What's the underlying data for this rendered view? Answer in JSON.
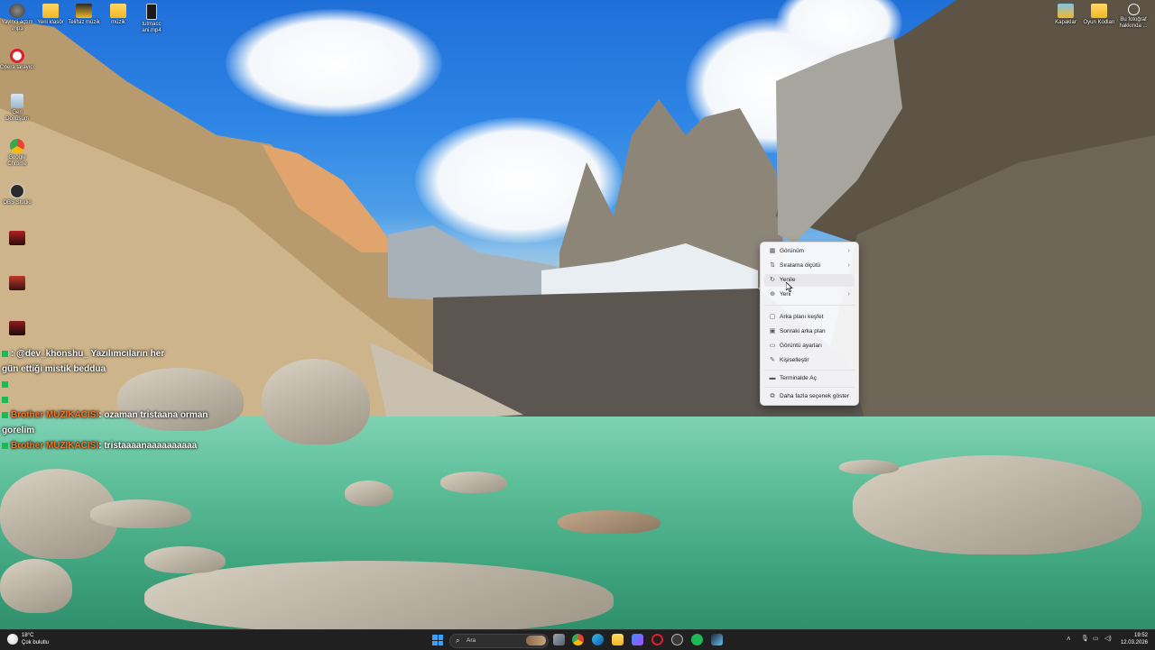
{
  "desktop_icons_left": [
    {
      "label": "Yayinci açtım .mp3",
      "icon": "audio-file-icon"
    },
    {
      "label": "Opera tarayıcı",
      "icon": "opera-icon"
    },
    {
      "label": "Geri Dönüşüm",
      "icon": "recycle-bin-icon"
    },
    {
      "label": "Google Chrome",
      "icon": "chrome-icon"
    },
    {
      "label": "OBS Studio",
      "icon": "obs-icon"
    },
    {
      "label": "",
      "icon": "game-icon"
    },
    {
      "label": "",
      "icon": "game-icon"
    },
    {
      "label": "",
      "icon": "game-icon"
    }
  ],
  "desktop_icons_top": [
    {
      "label": "Yeni klasör",
      "icon": "folder-icon"
    },
    {
      "label": "Telifsiz müzik",
      "icon": "folder-icon"
    },
    {
      "label": "müzik",
      "icon": "folder-icon"
    },
    {
      "label": "tutmacc ani.mp4",
      "icon": "video-file-icon"
    }
  ],
  "desktop_icons_right": [
    {
      "label": "Kapaklar",
      "icon": "folder-icon"
    },
    {
      "label": "Oyun Kodları",
      "icon": "folder-icon"
    },
    {
      "label": "Bu fotoğraf hakkında ...",
      "icon": "info-icon"
    }
  ],
  "chat": [
    {
      "user": "",
      "user_color": "#20c8a8",
      "text": ": @dev_khonshu_ Yazılımcıların her"
    },
    {
      "user": "",
      "user_color": "#20c8a8",
      "text": "gün ettiği mistik beddua"
    },
    {
      "user": "",
      "user_color": "#e3b200",
      "text": ""
    },
    {
      "user": "",
      "user_color": "#20c8a8",
      "text": ""
    },
    {
      "user": "Brother MUZIKACISI",
      "user_color": "#f07a2a",
      "text": ": ozaman tristaana orman"
    },
    {
      "user": "",
      "user_color": "#f07a2a",
      "text": "gorelim"
    },
    {
      "user": "Brother MUZIKACISI",
      "user_color": "#f07a2a",
      "text": ": tristaaaanaaaaaaaaaa"
    }
  ],
  "context_menu": {
    "items": [
      {
        "label": "Görünüm",
        "icon": "grid-icon",
        "submenu": true
      },
      {
        "label": "Sıralama ölçütü",
        "icon": "sort-icon",
        "submenu": true
      },
      {
        "label": "Yenile",
        "icon": "refresh-icon",
        "submenu": false
      },
      {
        "label": "Yeni",
        "icon": "new-icon",
        "submenu": true
      },
      {
        "label": "Arka planı keşfet",
        "icon": "explore-icon",
        "submenu": false
      },
      {
        "label": "Sonraki arka plan",
        "icon": "next-background-icon",
        "submenu": false
      },
      {
        "label": "Görüntü ayarları",
        "icon": "display-icon",
        "submenu": false
      },
      {
        "label": "Kişiselleştir",
        "icon": "personalize-icon",
        "submenu": false
      },
      {
        "label": "Terminalde Aç",
        "icon": "terminal-icon",
        "submenu": false
      },
      {
        "label": "Daha fazla seçenek göster",
        "icon": "more-options-icon",
        "submenu": false
      }
    ]
  },
  "taskbar": {
    "weather_temp": "18°C",
    "weather_desc": "Çok bulutlu",
    "search_placeholder": "Ara",
    "time": "19:52",
    "date": "12.03.2026",
    "colors": {
      "bg": "#202020",
      "accent": "#0078d4"
    }
  }
}
